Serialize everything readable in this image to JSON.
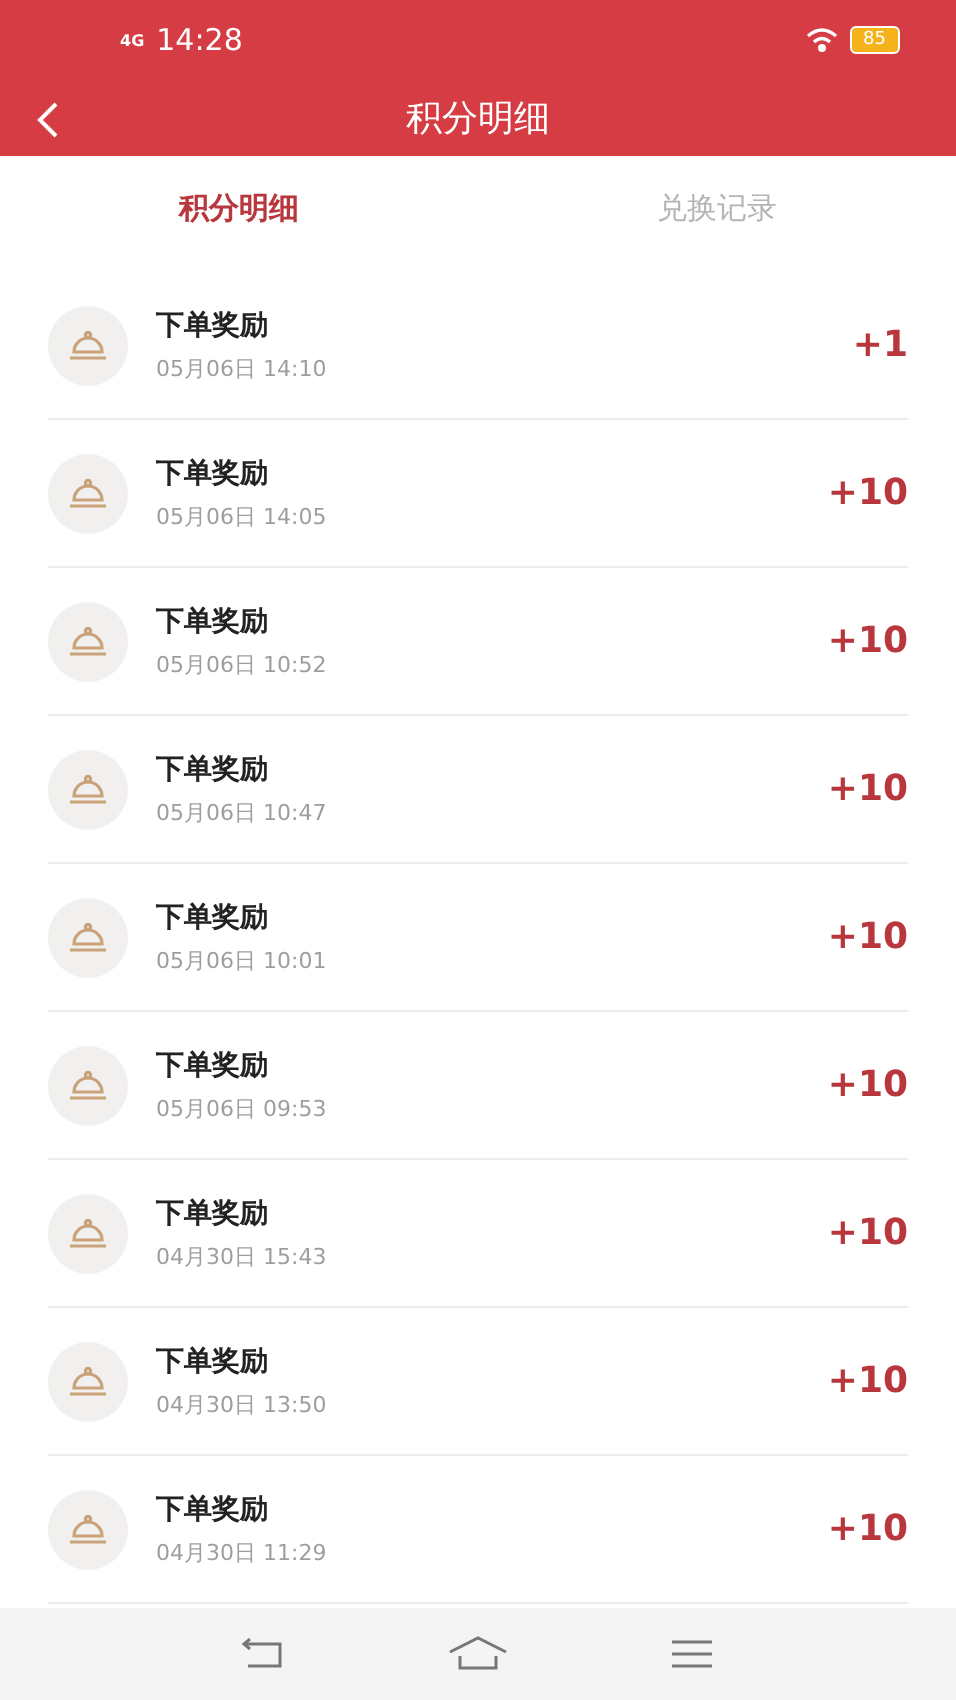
{
  "status_bar": {
    "network": "4G",
    "time": "14:28",
    "battery": "85"
  },
  "header": {
    "title": "积分明细"
  },
  "tabs": [
    {
      "label": "积分明细",
      "selected": true
    },
    {
      "label": "兑换记录",
      "selected": false
    }
  ],
  "records": [
    {
      "title": "下单奖励",
      "time": "05月06日 14:10",
      "points": "+1"
    },
    {
      "title": "下单奖励",
      "time": "05月06日 14:05",
      "points": "+10"
    },
    {
      "title": "下单奖励",
      "time": "05月06日 10:52",
      "points": "+10"
    },
    {
      "title": "下单奖励",
      "time": "05月06日 10:47",
      "points": "+10"
    },
    {
      "title": "下单奖励",
      "time": "05月06日 10:01",
      "points": "+10"
    },
    {
      "title": "下单奖励",
      "time": "05月06日 09:53",
      "points": "+10"
    },
    {
      "title": "下单奖励",
      "time": "04月30日 15:43",
      "points": "+10"
    },
    {
      "title": "下单奖励",
      "time": "04月30日 13:50",
      "points": "+10"
    },
    {
      "title": "下单奖励",
      "time": "04月30日 11:29",
      "points": "+10"
    }
  ]
}
